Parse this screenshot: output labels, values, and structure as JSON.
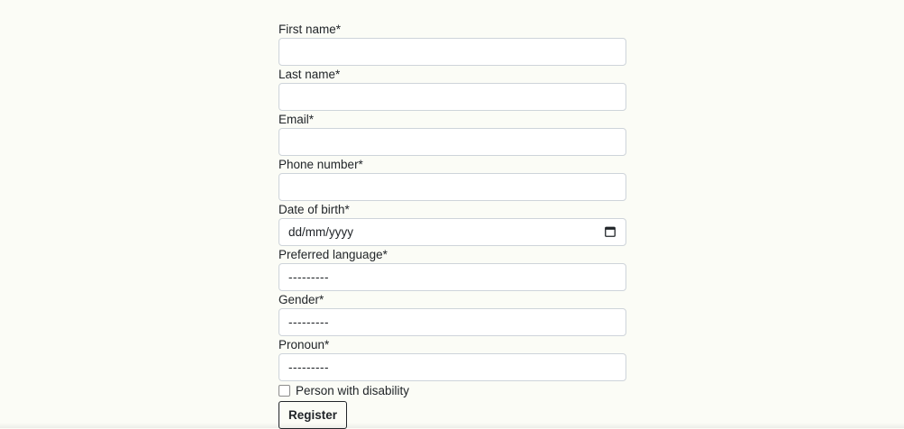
{
  "form": {
    "fields": [
      {
        "label": "First name*",
        "value": ""
      },
      {
        "label": "Last name*",
        "value": ""
      },
      {
        "label": "Email*",
        "value": ""
      },
      {
        "label": "Phone number*",
        "value": ""
      },
      {
        "label": "Date of birth*",
        "placeholder": "dd/mm/yyyy"
      },
      {
        "label": "Preferred language*",
        "selected": "---------"
      },
      {
        "label": "Gender*",
        "selected": "---------"
      },
      {
        "label": "Pronoun*",
        "selected": "---------"
      }
    ],
    "checkbox": {
      "label": "Person with disability",
      "checked": false
    },
    "submit_label": "Register"
  },
  "icons": {
    "date_picker": "calendar-icon"
  }
}
